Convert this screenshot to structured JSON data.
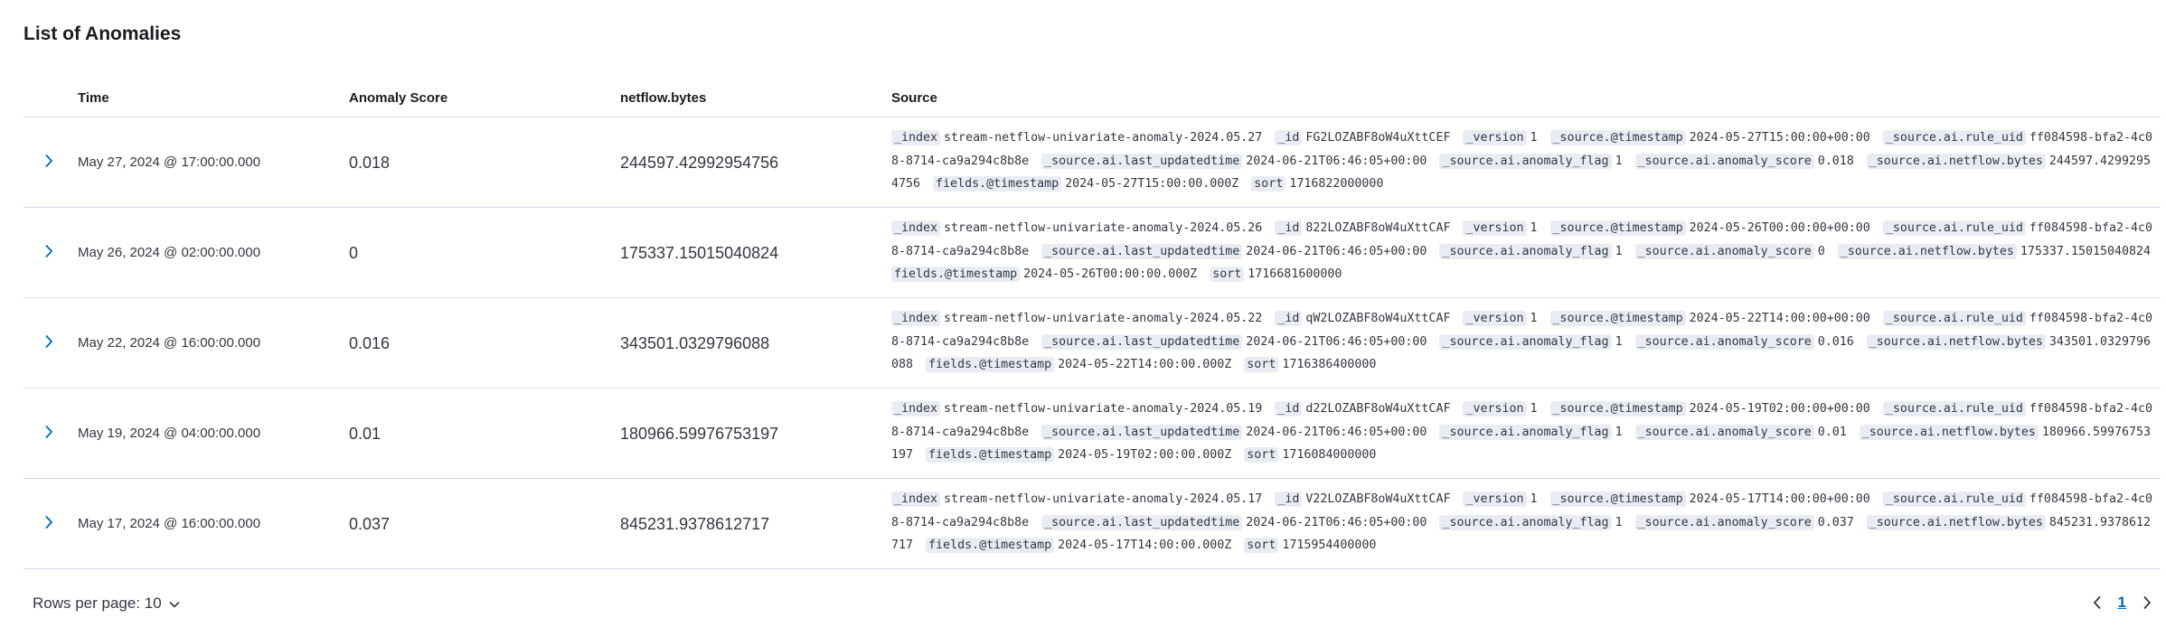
{
  "title": "List of Anomalies",
  "columns": {
    "time": "Time",
    "score": "Anomaly Score",
    "bytes": "netflow.bytes",
    "source": "Source"
  },
  "rows": [
    {
      "time": "May 27, 2024 @ 17:00:00.000",
      "score": "0.018",
      "bytes": "244597.42992954756",
      "source": [
        {
          "k": "_index",
          "v": "stream-netflow-univariate-anomaly-2024.05.27"
        },
        {
          "k": "_id",
          "v": "FG2LOZABF8oW4uXttCEF"
        },
        {
          "k": "_version",
          "v": "1"
        },
        {
          "k": "_source.@timestamp",
          "v": "2024-05-27T15:00:00+00:00"
        },
        {
          "k": "_source.ai.rule_uid",
          "v": "ff084598-bfa2-4c08-8714-ca9a294c8b8e"
        },
        {
          "k": "_source.ai.last_updatedtime",
          "v": "2024-06-21T06:46:05+00:00"
        },
        {
          "k": "_source.ai.anomaly_flag",
          "v": "1"
        },
        {
          "k": "_source.ai.anomaly_score",
          "v": "0.018"
        },
        {
          "k": "_source.ai.netflow.bytes",
          "v": "244597.42992954756"
        },
        {
          "k": "fields.@timestamp",
          "v": "2024-05-27T15:00:00.000Z"
        },
        {
          "k": "sort",
          "v": "1716822000000"
        }
      ]
    },
    {
      "time": "May 26, 2024 @ 02:00:00.000",
      "score": "0",
      "bytes": "175337.15015040824",
      "source": [
        {
          "k": "_index",
          "v": "stream-netflow-univariate-anomaly-2024.05.26"
        },
        {
          "k": "_id",
          "v": "822LOZABF8oW4uXttCAF"
        },
        {
          "k": "_version",
          "v": "1"
        },
        {
          "k": "_source.@timestamp",
          "v": "2024-05-26T00:00:00+00:00"
        },
        {
          "k": "_source.ai.rule_uid",
          "v": "ff084598-bfa2-4c08-8714-ca9a294c8b8e"
        },
        {
          "k": "_source.ai.last_updatedtime",
          "v": "2024-06-21T06:46:05+00:00"
        },
        {
          "k": "_source.ai.anomaly_flag",
          "v": "1"
        },
        {
          "k": "_source.ai.anomaly_score",
          "v": "0"
        },
        {
          "k": "_source.ai.netflow.bytes",
          "v": "175337.15015040824"
        },
        {
          "k": "fields.@timestamp",
          "v": "2024-05-26T00:00:00.000Z"
        },
        {
          "k": "sort",
          "v": "1716681600000"
        }
      ]
    },
    {
      "time": "May 22, 2024 @ 16:00:00.000",
      "score": "0.016",
      "bytes": "343501.0329796088",
      "source": [
        {
          "k": "_index",
          "v": "stream-netflow-univariate-anomaly-2024.05.22"
        },
        {
          "k": "_id",
          "v": "qW2LOZABF8oW4uXttCAF"
        },
        {
          "k": "_version",
          "v": "1"
        },
        {
          "k": "_source.@timestamp",
          "v": "2024-05-22T14:00:00+00:00"
        },
        {
          "k": "_source.ai.rule_uid",
          "v": "ff084598-bfa2-4c08-8714-ca9a294c8b8e"
        },
        {
          "k": "_source.ai.last_updatedtime",
          "v": "2024-06-21T06:46:05+00:00"
        },
        {
          "k": "_source.ai.anomaly_flag",
          "v": "1"
        },
        {
          "k": "_source.ai.anomaly_score",
          "v": "0.016"
        },
        {
          "k": "_source.ai.netflow.bytes",
          "v": "343501.0329796088"
        },
        {
          "k": "fields.@timestamp",
          "v": "2024-05-22T14:00:00.000Z"
        },
        {
          "k": "sort",
          "v": "1716386400000"
        }
      ]
    },
    {
      "time": "May 19, 2024 @ 04:00:00.000",
      "score": "0.01",
      "bytes": "180966.59976753197",
      "source": [
        {
          "k": "_index",
          "v": "stream-netflow-univariate-anomaly-2024.05.19"
        },
        {
          "k": "_id",
          "v": "d22LOZABF8oW4uXttCAF"
        },
        {
          "k": "_version",
          "v": "1"
        },
        {
          "k": "_source.@timestamp",
          "v": "2024-05-19T02:00:00+00:00"
        },
        {
          "k": "_source.ai.rule_uid",
          "v": "ff084598-bfa2-4c08-8714-ca9a294c8b8e"
        },
        {
          "k": "_source.ai.last_updatedtime",
          "v": "2024-06-21T06:46:05+00:00"
        },
        {
          "k": "_source.ai.anomaly_flag",
          "v": "1"
        },
        {
          "k": "_source.ai.anomaly_score",
          "v": "0.01"
        },
        {
          "k": "_source.ai.netflow.bytes",
          "v": "180966.59976753197"
        },
        {
          "k": "fields.@timestamp",
          "v": "2024-05-19T02:00:00.000Z"
        },
        {
          "k": "sort",
          "v": "1716084000000"
        }
      ]
    },
    {
      "time": "May 17, 2024 @ 16:00:00.000",
      "score": "0.037",
      "bytes": "845231.9378612717",
      "source": [
        {
          "k": "_index",
          "v": "stream-netflow-univariate-anomaly-2024.05.17"
        },
        {
          "k": "_id",
          "v": "V22LOZABF8oW4uXttCAF"
        },
        {
          "k": "_version",
          "v": "1"
        },
        {
          "k": "_source.@timestamp",
          "v": "2024-05-17T14:00:00+00:00"
        },
        {
          "k": "_source.ai.rule_uid",
          "v": "ff084598-bfa2-4c08-8714-ca9a294c8b8e"
        },
        {
          "k": "_source.ai.last_updatedtime",
          "v": "2024-06-21T06:46:05+00:00"
        },
        {
          "k": "_source.ai.anomaly_flag",
          "v": "1"
        },
        {
          "k": "_source.ai.anomaly_score",
          "v": "0.037"
        },
        {
          "k": "_source.ai.netflow.bytes",
          "v": "845231.9378612717"
        },
        {
          "k": "fields.@timestamp",
          "v": "2024-05-17T14:00:00.000Z"
        },
        {
          "k": "sort",
          "v": "1715954400000"
        }
      ]
    }
  ],
  "footer": {
    "rows_per_page": "Rows per page: 10",
    "current_page": "1"
  },
  "icons": {
    "expand": "chevron-right-icon",
    "rows_dropdown": "chevron-down-icon",
    "prev": "chevron-left-icon",
    "next": "chevron-right-icon"
  },
  "colors": {
    "accent": "#006bb8",
    "key_badge": "#e9edf3",
    "border": "#d3dae6"
  }
}
